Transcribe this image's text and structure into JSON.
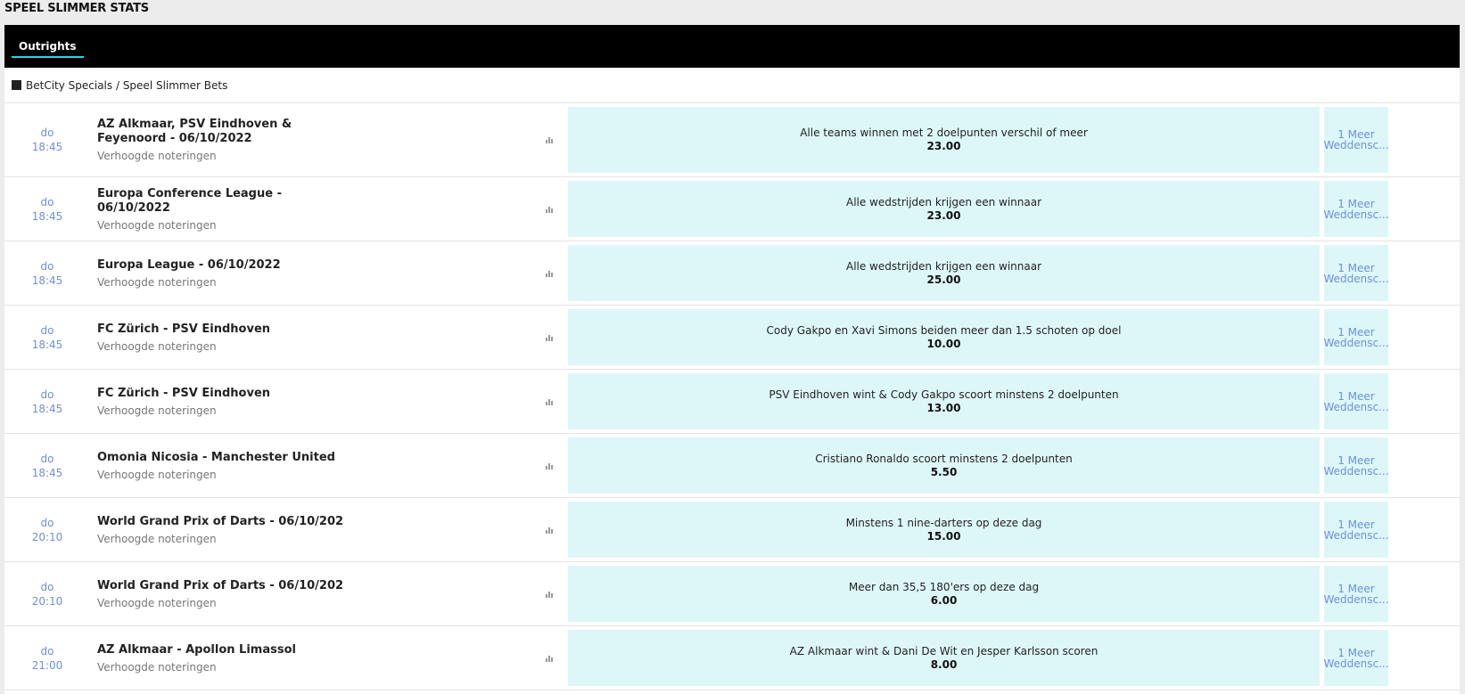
{
  "page": {
    "title": "SPEEL SLIMMER STATS"
  },
  "tabs": [
    {
      "label": "Outrights",
      "active": true
    }
  ],
  "section": {
    "label": "BetCity Specials / Speel Slimmer Bets"
  },
  "events": [
    {
      "day": "do",
      "time": "18:45",
      "name": "AZ Alkmaar, PSV Eindhoven & Feyenoord - 06/10/2022",
      "sub": "Verhoogde noteringen",
      "bet_label": "Alle teams winnen met 2 doelpunten verschil of meer",
      "odds": "23.00",
      "more_line1": "1 Meer",
      "more_line2": "Weddensc..."
    },
    {
      "day": "do",
      "time": "18:45",
      "name": "Europa Conference League - 06/10/2022",
      "sub": "Verhoogde noteringen",
      "bet_label": "Alle wedstrijden krijgen een winnaar",
      "odds": "23.00",
      "more_line1": "1 Meer",
      "more_line2": "Weddensc..."
    },
    {
      "day": "do",
      "time": "18:45",
      "name": "Europa League - 06/10/2022",
      "sub": "Verhoogde noteringen",
      "bet_label": "Alle wedstrijden krijgen een winnaar",
      "odds": "25.00",
      "more_line1": "1 Meer",
      "more_line2": "Weddensc..."
    },
    {
      "day": "do",
      "time": "18:45",
      "name": "FC Zürich - PSV Eindhoven",
      "sub": "Verhoogde noteringen",
      "bet_label": "Cody Gakpo en Xavi Simons beiden meer dan 1.5 schoten op doel",
      "odds": "10.00",
      "more_line1": "1 Meer",
      "more_line2": "Weddensc..."
    },
    {
      "day": "do",
      "time": "18:45",
      "name": "FC Zürich - PSV Eindhoven",
      "sub": "Verhoogde noteringen",
      "bet_label": "PSV Eindhoven wint & Cody Gakpo scoort minstens 2 doelpunten",
      "odds": "13.00",
      "more_line1": "1 Meer",
      "more_line2": "Weddensc..."
    },
    {
      "day": "do",
      "time": "18:45",
      "name": "Omonia Nicosia - Manchester United",
      "sub": "Verhoogde noteringen",
      "bet_label": "Cristiano Ronaldo scoort minstens 2 doelpunten",
      "odds": "5.50",
      "more_line1": "1 Meer",
      "more_line2": "Weddensc..."
    },
    {
      "day": "do",
      "time": "20:10",
      "name": "World Grand Prix of Darts - 06/10/202",
      "sub": "Verhoogde noteringen",
      "bet_label": "Minstens 1 nine-darters op deze dag",
      "odds": "15.00",
      "more_line1": "1 Meer",
      "more_line2": "Weddensc..."
    },
    {
      "day": "do",
      "time": "20:10",
      "name": "World Grand Prix of Darts - 06/10/202",
      "sub": "Verhoogde noteringen",
      "bet_label": "Meer dan 35,5 180'ers op deze dag",
      "odds": "6.00",
      "more_line1": "1 Meer",
      "more_line2": "Weddensc..."
    },
    {
      "day": "do",
      "time": "21:00",
      "name": "AZ Alkmaar - Apollon Limassol",
      "sub": "Verhoogde noteringen",
      "bet_label": "AZ Alkmaar wint & Dani De Wit en Jesper Karlsson scoren",
      "odds": "8.00",
      "more_line1": "1 Meer",
      "more_line2": "Weddensc..."
    }
  ],
  "colors": {
    "accent": "#2fd3e0",
    "odds_bg": "#ddf7f9",
    "time_text": "#6f8fd8",
    "tabbar_bg": "#000000"
  },
  "icons": {
    "stats": "bar-chart-icon",
    "section": "square-icon"
  }
}
